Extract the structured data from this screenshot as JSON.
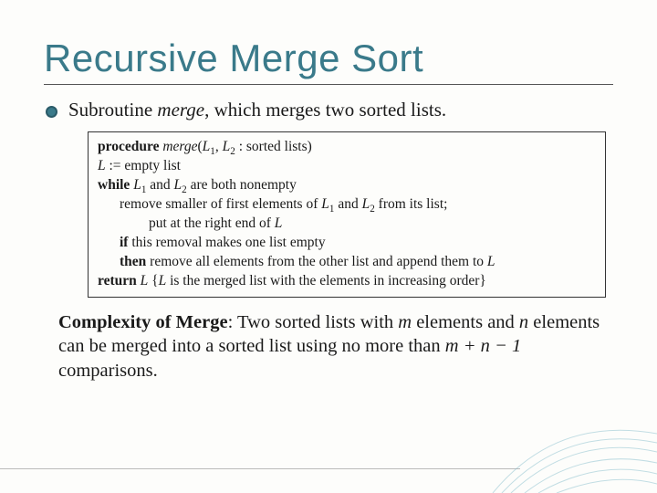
{
  "title": "Recursive Merge Sort",
  "bullet": {
    "pre": "Subroutine ",
    "italic": "merge",
    "post": ", which merges two sorted lists."
  },
  "code": {
    "l1a": "procedure ",
    "l1b": "merge",
    "l1c": "(",
    "l1d": "L",
    "l1d_sub": "1",
    "l1e": ", ",
    "l1f": "L",
    "l1f_sub": "2",
    "l1g": " : sorted lists)",
    "l2a": "L",
    "l2b": " := empty list",
    "l3a": "while ",
    "l3b": "L",
    "l3b_sub": "1",
    "l3c": " and ",
    "l3d": "L",
    "l3d_sub": "2",
    "l3e": " are both nonempty",
    "l4a": "remove smaller of first elements of ",
    "l4b": "L",
    "l4b_sub": "1",
    "l4c": " and ",
    "l4d": "L",
    "l4d_sub": "2",
    "l4e": " from its list;",
    "l5a": "put at the right end of ",
    "l5b": "L",
    "l6a": "if",
    "l6b": " this removal makes one list empty",
    "l7a": "then",
    "l7b": " remove all elements from the other list and append them to ",
    "l7c": "L",
    "l8a": "return ",
    "l8b": "L",
    "l8c": " {",
    "l8d": "L",
    "l8e": " is the merged list with the elements in increasing order}"
  },
  "complexity": {
    "bold": "Complexity of Merge",
    "t1": ": Two sorted lists with ",
    "m": "m",
    "t2": " elements and ",
    "n": "n",
    "t3": " elements can be merged into a sorted list using no more than ",
    "expr": "m + n − 1",
    "t4": " comparisons."
  }
}
